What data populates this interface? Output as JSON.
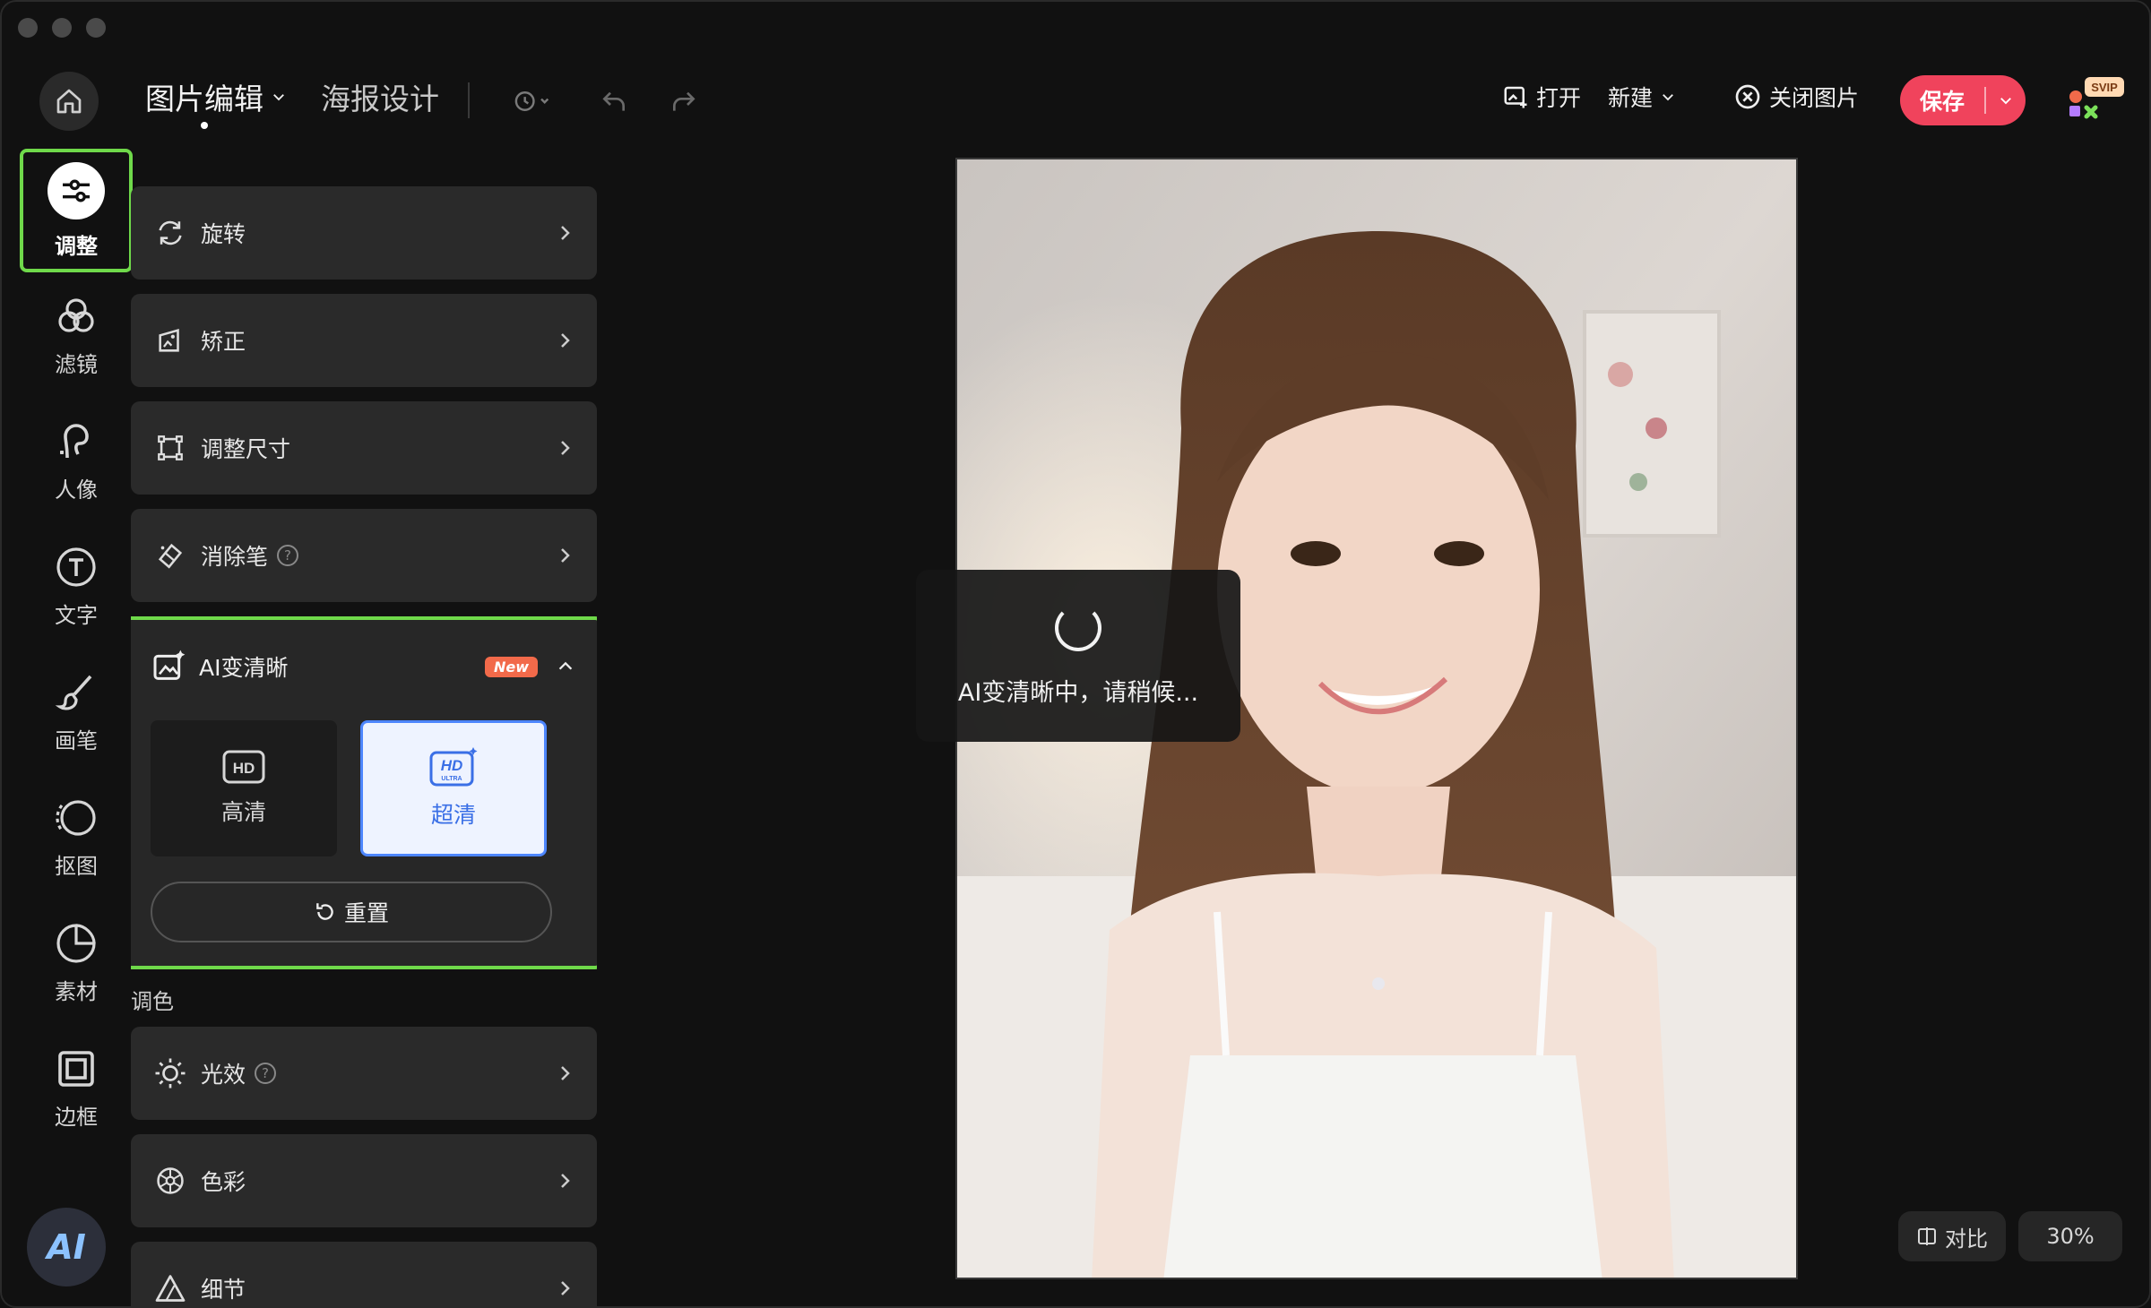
{
  "header": {
    "tab_edit": "图片编辑",
    "tab_poster": "海报设计",
    "open": "打开",
    "new": "新建",
    "close_image": "关闭图片",
    "save": "保存",
    "svip": "SVIP"
  },
  "rail": {
    "items": [
      {
        "label": "调整",
        "icon": "sliders-icon",
        "active": true
      },
      {
        "label": "滤镜",
        "icon": "filter-circles-icon"
      },
      {
        "label": "人像",
        "icon": "portrait-icon"
      },
      {
        "label": "文字",
        "icon": "text-icon"
      },
      {
        "label": "画笔",
        "icon": "brush-icon"
      },
      {
        "label": "抠图",
        "icon": "cutout-icon"
      },
      {
        "label": "素材",
        "icon": "sticker-icon"
      },
      {
        "label": "边框",
        "icon": "frame-icon"
      }
    ],
    "ai_label": "AI"
  },
  "panel": {
    "cards": [
      {
        "label": "旋转",
        "icon": "rotate-icon"
      },
      {
        "label": "矫正",
        "icon": "straighten-icon"
      },
      {
        "label": "调整尺寸",
        "icon": "resize-icon"
      },
      {
        "label": "消除笔",
        "icon": "eraser-icon"
      }
    ],
    "ai_enhance": {
      "title": "AI变清晰",
      "badge": "New",
      "option_hd_icon_text": "HD",
      "option_hd": "高清",
      "option_uhd_icon_text": "HD",
      "option_uhd_sub": "ULTRA",
      "option_uhd": "超清",
      "reset": "重置"
    },
    "color_section": "调色",
    "color_cards": [
      {
        "label": "光效",
        "icon": "sun-icon"
      },
      {
        "label": "色彩",
        "icon": "color-wheel-icon"
      },
      {
        "label": "细节",
        "icon": "triangle-icon"
      }
    ]
  },
  "canvas": {
    "loading_text": "AI变清晰中，请稍候...",
    "compare": "对比",
    "zoom": "30%"
  },
  "colors": {
    "accent_green": "#6fd94a",
    "save_red": "#f0435c",
    "uhd_blue": "#4d86ff"
  }
}
